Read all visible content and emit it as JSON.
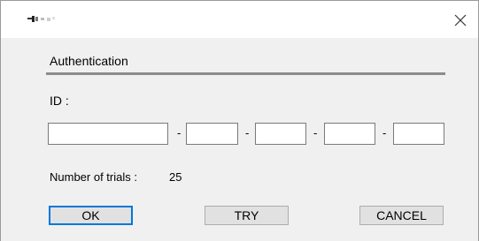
{
  "window": {
    "app_icon": "blurred-app-icon",
    "close_icon": "close-icon"
  },
  "auth": {
    "section_label": "Authentication",
    "id_label": "ID :",
    "id_fields": [
      "",
      "",
      "",
      "",
      ""
    ],
    "separators": [
      "-",
      "-",
      "-",
      "-"
    ],
    "trials_label": "Number of trials :",
    "trials_value": "25"
  },
  "buttons": {
    "ok": "OK",
    "try": "TRY",
    "cancel": "CANCEL"
  },
  "colors": {
    "focus_border": "#0078d7",
    "client_bg": "#f0f0f0"
  }
}
